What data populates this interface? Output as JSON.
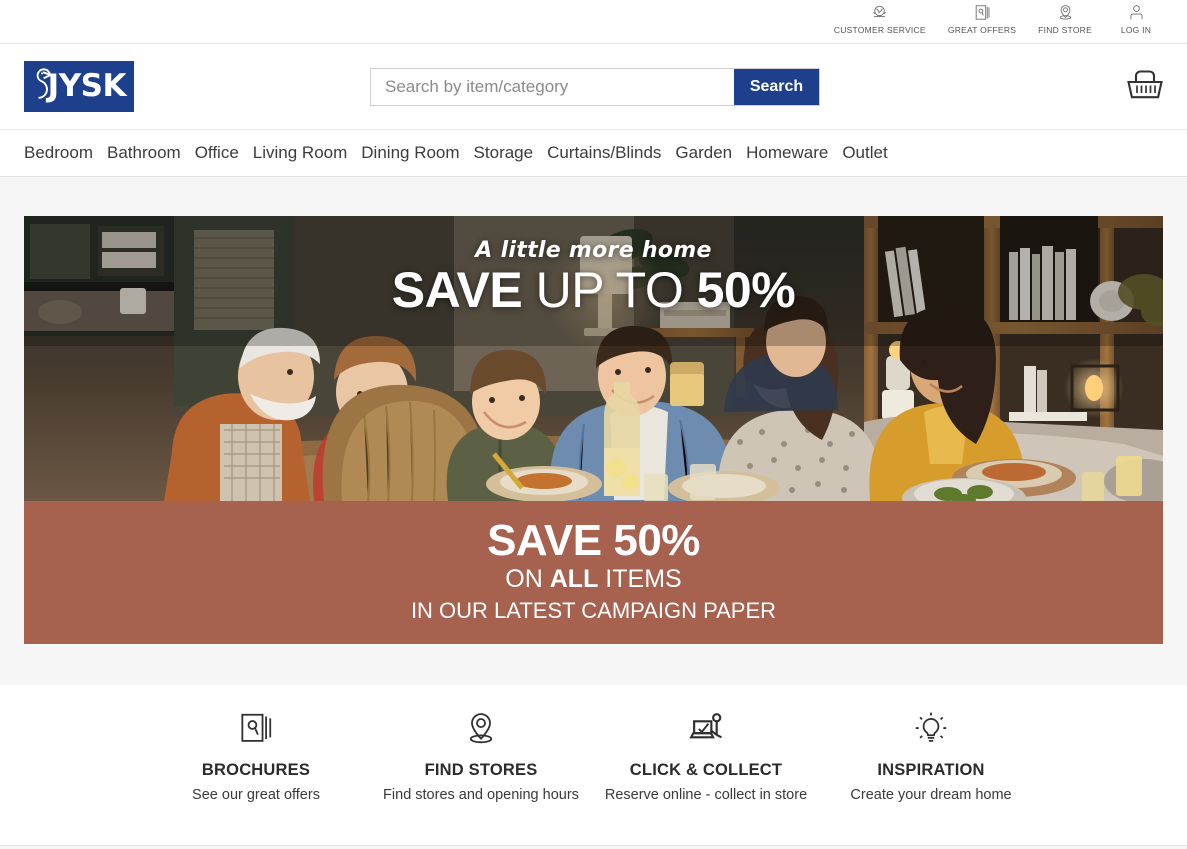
{
  "topbar": {
    "items": [
      {
        "label": "CUSTOMER SERVICE",
        "icon": "customer-service-icon"
      },
      {
        "label": "GREAT OFFERS",
        "icon": "great-offers-icon"
      },
      {
        "label": "FIND STORE",
        "icon": "find-store-icon"
      },
      {
        "label": "LOG IN",
        "icon": "user-icon"
      }
    ]
  },
  "header": {
    "logo_text": "JYSK",
    "logo_icon": "jysk-goose-logo",
    "search": {
      "placeholder": "Search by item/category",
      "value": "",
      "button_label": "Search"
    },
    "cart_icon": "shopping-basket-icon"
  },
  "nav": {
    "items": [
      "Bedroom",
      "Bathroom",
      "Office",
      "Living Room",
      "Dining Room",
      "Storage",
      "Curtains/Blinds",
      "Garden",
      "Homeware",
      "Outlet"
    ]
  },
  "hero": {
    "kicker": "A little more home",
    "headline_part1": "SAVE",
    "headline_part2": "UP TO",
    "headline_part3": "50%"
  },
  "promo": {
    "line1": "SAVE 50%",
    "line2_pre": "ON ",
    "line2_bold": "ALL",
    "line2_post": " ITEMS",
    "line3": "IN OUR LATEST CAMPAIGN PAPER",
    "background_color": "#a6614f"
  },
  "services": [
    {
      "icon": "brochure-icon",
      "title": "BROCHURES",
      "subtitle": "See our great offers"
    },
    {
      "icon": "map-pin-icon",
      "title": "FIND STORES",
      "subtitle": "Find stores and opening hours"
    },
    {
      "icon": "click-collect-icon",
      "title": "CLICK & COLLECT",
      "subtitle": "Reserve online - collect in store"
    },
    {
      "icon": "lightbulb-icon",
      "title": "INSPIRATION",
      "subtitle": "Create your dream home"
    }
  ],
  "colors": {
    "brand_blue": "#1d3f8c",
    "promo_terracotta": "#a6614f",
    "page_background": "#f6f6f6"
  }
}
